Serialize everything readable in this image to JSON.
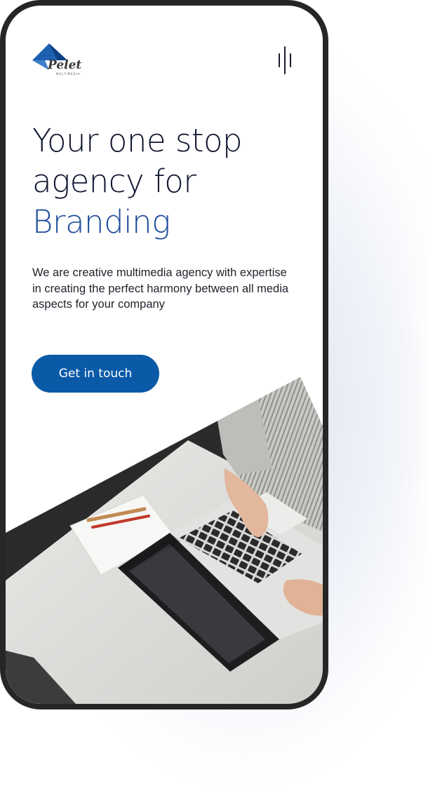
{
  "header": {
    "logo_text": "Pelet",
    "logo_subtext": "MULTIMEDIA",
    "menu_icon": "hamburger-menu-icon"
  },
  "hero": {
    "headline_line1": "Your one stop",
    "headline_line2": "agency for",
    "headline_accent": "Branding",
    "description": "We are creative multimedia agency with expertise in creating the perfect harmony between all media aspects for your company",
    "cta_label": "Get in touch",
    "image_subject": "workspace-laptop-photo"
  },
  "colors": {
    "accent": "#1d4d9a",
    "button": "#0a5aa7",
    "heading": "#0f1530",
    "phone_frame": "#262626"
  }
}
